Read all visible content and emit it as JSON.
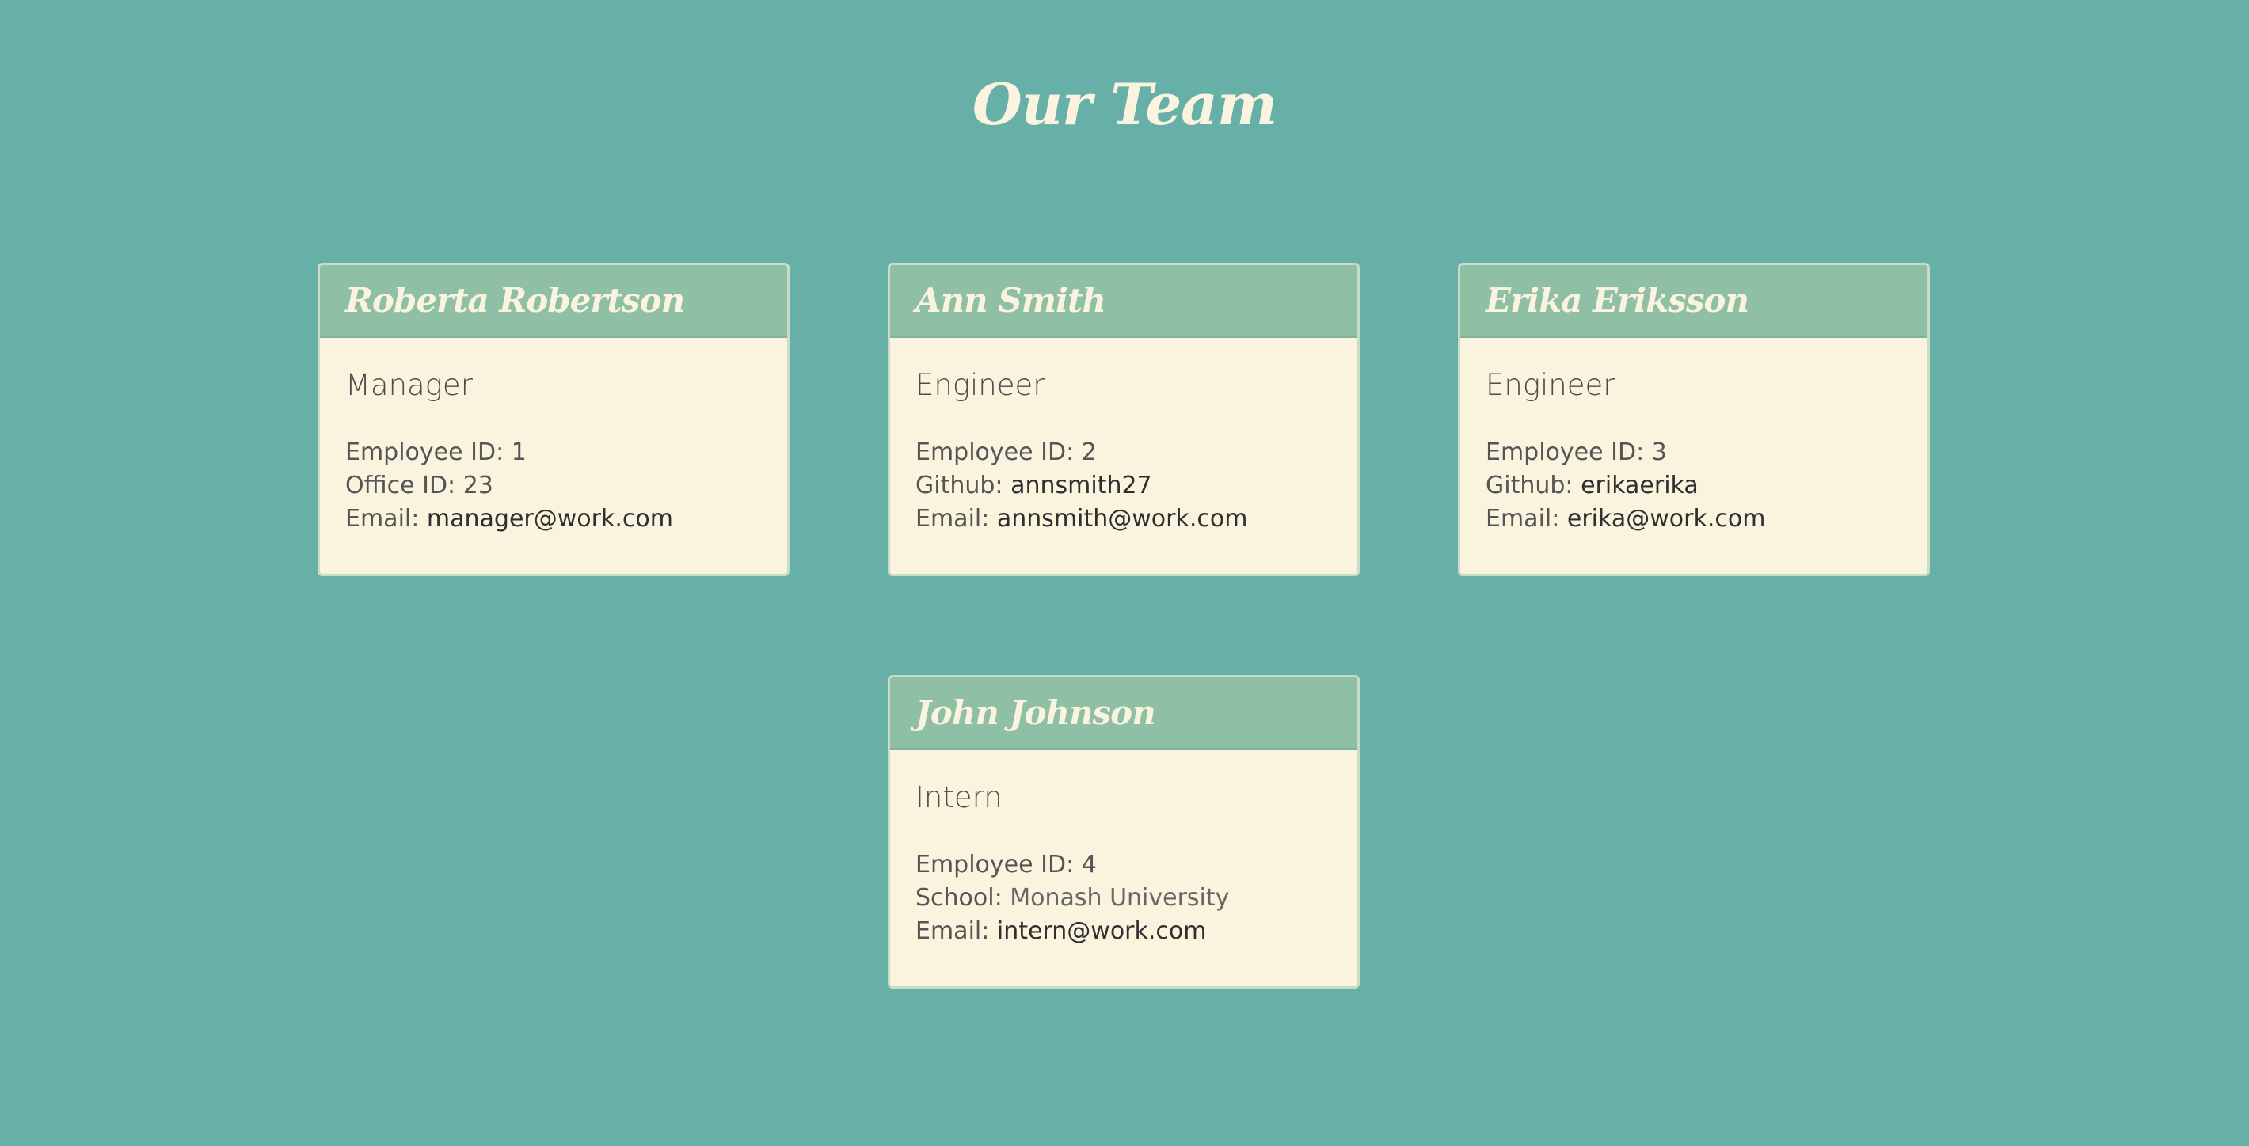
{
  "page": {
    "title": "Our Team"
  },
  "colors": {
    "background": "#67b0a8",
    "card_background": "#faf3dd",
    "card_header": "#8fbfa5",
    "title_text": "#faf3dd"
  },
  "team": [
    {
      "name": "Roberta Robertson",
      "role": "Manager",
      "id_label": "Employee ID:",
      "id_value": "1",
      "extra_label": "Office ID:",
      "extra_value": "23",
      "email_label": "Email:",
      "email_value": "manager@work.com"
    },
    {
      "name": "Ann Smith",
      "role": "Engineer",
      "id_label": "Employee ID:",
      "id_value": "2",
      "extra_label": "Github:",
      "extra_value": "annsmith27",
      "email_label": "Email:",
      "email_value": "annsmith@work.com"
    },
    {
      "name": "Erika Eriksson",
      "role": "Engineer",
      "id_label": "Employee ID:",
      "id_value": "3",
      "extra_label": "Github:",
      "extra_value": "erikaerika",
      "email_label": "Email:",
      "email_value": "erika@work.com"
    },
    {
      "name": "John Johnson",
      "role": "Intern",
      "id_label": "Employee ID:",
      "id_value": "4",
      "extra_label": "School:",
      "extra_value": "Monash University",
      "email_label": "Email:",
      "email_value": "intern@work.com"
    }
  ]
}
